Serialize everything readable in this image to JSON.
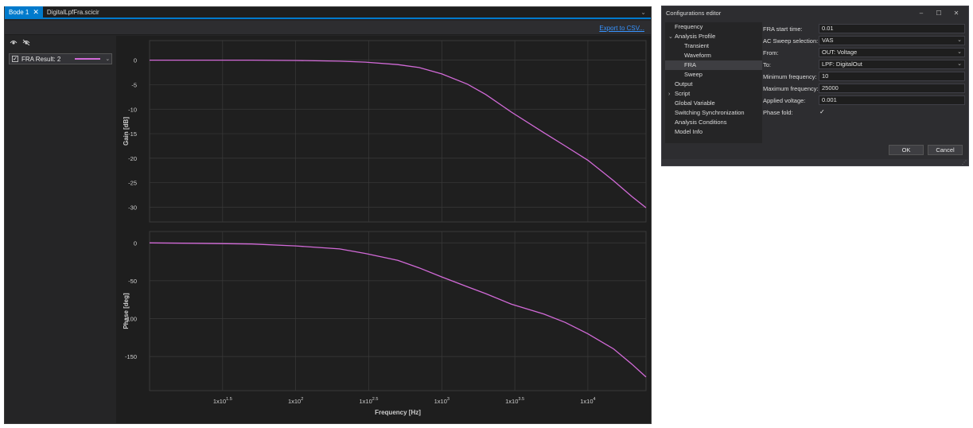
{
  "bode": {
    "tabs": [
      {
        "label": "Bode 1",
        "close": "✕"
      },
      {
        "label": "DigitalLpfFra.scicir"
      }
    ],
    "tab_menu": "⌄",
    "export_label": "Export to CSV...",
    "legend": {
      "item_label": "FRA Result: 2",
      "check": "✓",
      "dropdown": "⌄",
      "icons": [
        "eye-icon",
        "eye-hidden-icon"
      ],
      "series_color": "#d26ad8"
    }
  },
  "chart_data": [
    {
      "type": "line",
      "ylabel": "Gain [dB]",
      "xscale": "log",
      "xlim": [
        10,
        25000
      ],
      "ylim": [
        -33,
        4
      ],
      "yticks": [
        0,
        -5,
        -10,
        -15,
        -20,
        -25,
        -30
      ],
      "grid": true,
      "series": [
        {
          "name": "FRA Result: 2",
          "color": "#d26ad8",
          "x": [
            10,
            20,
            50,
            100,
            200,
            300,
            500,
            700,
            1000,
            1500,
            2000,
            3000,
            5000,
            7000,
            10000,
            15000,
            20000,
            25000
          ],
          "y": [
            0,
            0,
            0,
            -0.05,
            -0.2,
            -0.4,
            -0.9,
            -1.5,
            -2.8,
            -4.9,
            -7,
            -10.6,
            -14.8,
            -17.5,
            -20.4,
            -24.6,
            -27.8,
            -30.1
          ]
        }
      ]
    },
    {
      "type": "line",
      "xlabel": "Frequency [Hz]",
      "ylabel": "Phase [deg]",
      "xscale": "log",
      "xlim": [
        10,
        25000
      ],
      "ylim": [
        -195,
        15
      ],
      "yticks": [
        0,
        -50,
        -100,
        -150
      ],
      "xticks": [
        "1x10^1.5",
        "1x10^2",
        "1x10^2.5",
        "1x10^3",
        "1x10^3.5",
        "1x10^4"
      ],
      "grid": true,
      "series": [
        {
          "name": "FRA Result: 2",
          "color": "#d26ad8",
          "x": [
            10,
            20,
            50,
            100,
            200,
            300,
            500,
            700,
            1000,
            1500,
            2000,
            3000,
            5000,
            7000,
            10000,
            15000,
            20000,
            25000
          ],
          "y": [
            0,
            -0.5,
            -1.5,
            -4,
            -8,
            -14,
            -23,
            -33,
            -45,
            -58,
            -67,
            -81,
            -94,
            -105,
            -120,
            -140,
            -160,
            -177
          ]
        }
      ]
    }
  ],
  "config": {
    "title": "Configurations editor",
    "controls": [
      "–",
      "☐",
      "✕"
    ],
    "tree": [
      {
        "label": "Frequency",
        "level": 1,
        "arrow": ""
      },
      {
        "label": "Analysis Profile",
        "level": 0,
        "arrow": "⌄"
      },
      {
        "label": "Transient",
        "level": 2,
        "arrow": ""
      },
      {
        "label": "Waveform",
        "level": 2,
        "arrow": ""
      },
      {
        "label": "FRA",
        "level": 2,
        "arrow": "",
        "selected": true
      },
      {
        "label": "Sweep",
        "level": 2,
        "arrow": ""
      },
      {
        "label": "Output",
        "level": 1,
        "arrow": ""
      },
      {
        "label": "Script",
        "level": 0,
        "arrow": "›"
      },
      {
        "label": "Global Variable",
        "level": 1,
        "arrow": ""
      },
      {
        "label": "Switching Synchronization",
        "level": 1,
        "arrow": ""
      },
      {
        "label": "Analysis Conditions",
        "level": 1,
        "arrow": ""
      },
      {
        "label": "Model Info",
        "level": 1,
        "arrow": ""
      }
    ],
    "props": [
      {
        "label": "FRA start time:",
        "value": "0.01",
        "kind": "text"
      },
      {
        "label": "AC Sweep selection:",
        "value": "VAS",
        "kind": "select"
      },
      {
        "label": "From:",
        "value": "OUT: Voltage",
        "kind": "select"
      },
      {
        "label": "To:",
        "value": "LPF: DigitalOut",
        "kind": "select"
      },
      {
        "label": "Minimum frequency:",
        "value": "10",
        "kind": "text"
      },
      {
        "label": "Maximum frequency:",
        "value": "25000",
        "kind": "text"
      },
      {
        "label": "Applied voltage:",
        "value": "0.001",
        "kind": "text"
      },
      {
        "label": "Phase fold:",
        "value": "✓",
        "kind": "check"
      }
    ],
    "chevron": "⌄",
    "ok_label": "OK",
    "cancel_label": "Cancel",
    "grip": "⋰"
  }
}
